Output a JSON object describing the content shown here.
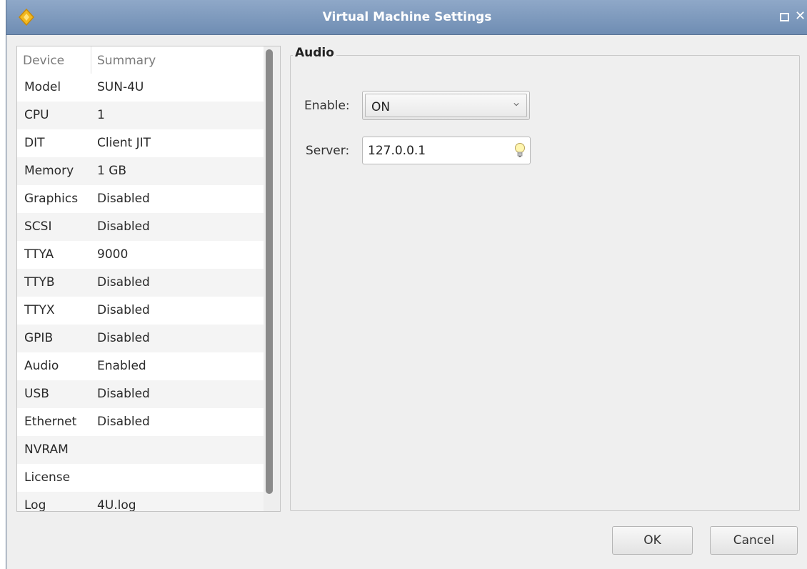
{
  "window": {
    "title": "Virtual Machine Settings",
    "close_glyph": "✕"
  },
  "device_list": {
    "headers": {
      "device": "Device",
      "summary": "Summary"
    },
    "rows": [
      {
        "device": "Model",
        "summary": "SUN-4U"
      },
      {
        "device": "CPU",
        "summary": "1"
      },
      {
        "device": "DIT",
        "summary": "Client JIT"
      },
      {
        "device": "Memory",
        "summary": "1 GB"
      },
      {
        "device": "Graphics",
        "summary": "Disabled"
      },
      {
        "device": "SCSI",
        "summary": "Disabled"
      },
      {
        "device": "TTYA",
        "summary": "9000"
      },
      {
        "device": "TTYB",
        "summary": "Disabled"
      },
      {
        "device": "TTYX",
        "summary": "Disabled"
      },
      {
        "device": "GPIB",
        "summary": "Disabled"
      },
      {
        "device": "Audio",
        "summary": "Enabled"
      },
      {
        "device": "USB",
        "summary": "Disabled"
      },
      {
        "device": "Ethernet",
        "summary": "Disabled"
      },
      {
        "device": "NVRAM",
        "summary": ""
      },
      {
        "device": "License",
        "summary": ""
      },
      {
        "device": "Log",
        "summary": "4U.log"
      }
    ]
  },
  "audio": {
    "group_title": "Audio",
    "enable_label": "Enable:",
    "enable_value": "ON",
    "server_label": "Server:",
    "server_value": "127.0.0.1"
  },
  "buttons": {
    "ok": "OK",
    "cancel": "Cancel"
  },
  "icons": {
    "app": "app-logo-icon",
    "maximize": "maximize-icon",
    "close": "close-icon",
    "dropdown": "chevron-down-icon",
    "hint": "lightbulb-icon"
  },
  "colors": {
    "titlebar": "#7a96bb",
    "window_bg": "#efefef"
  }
}
